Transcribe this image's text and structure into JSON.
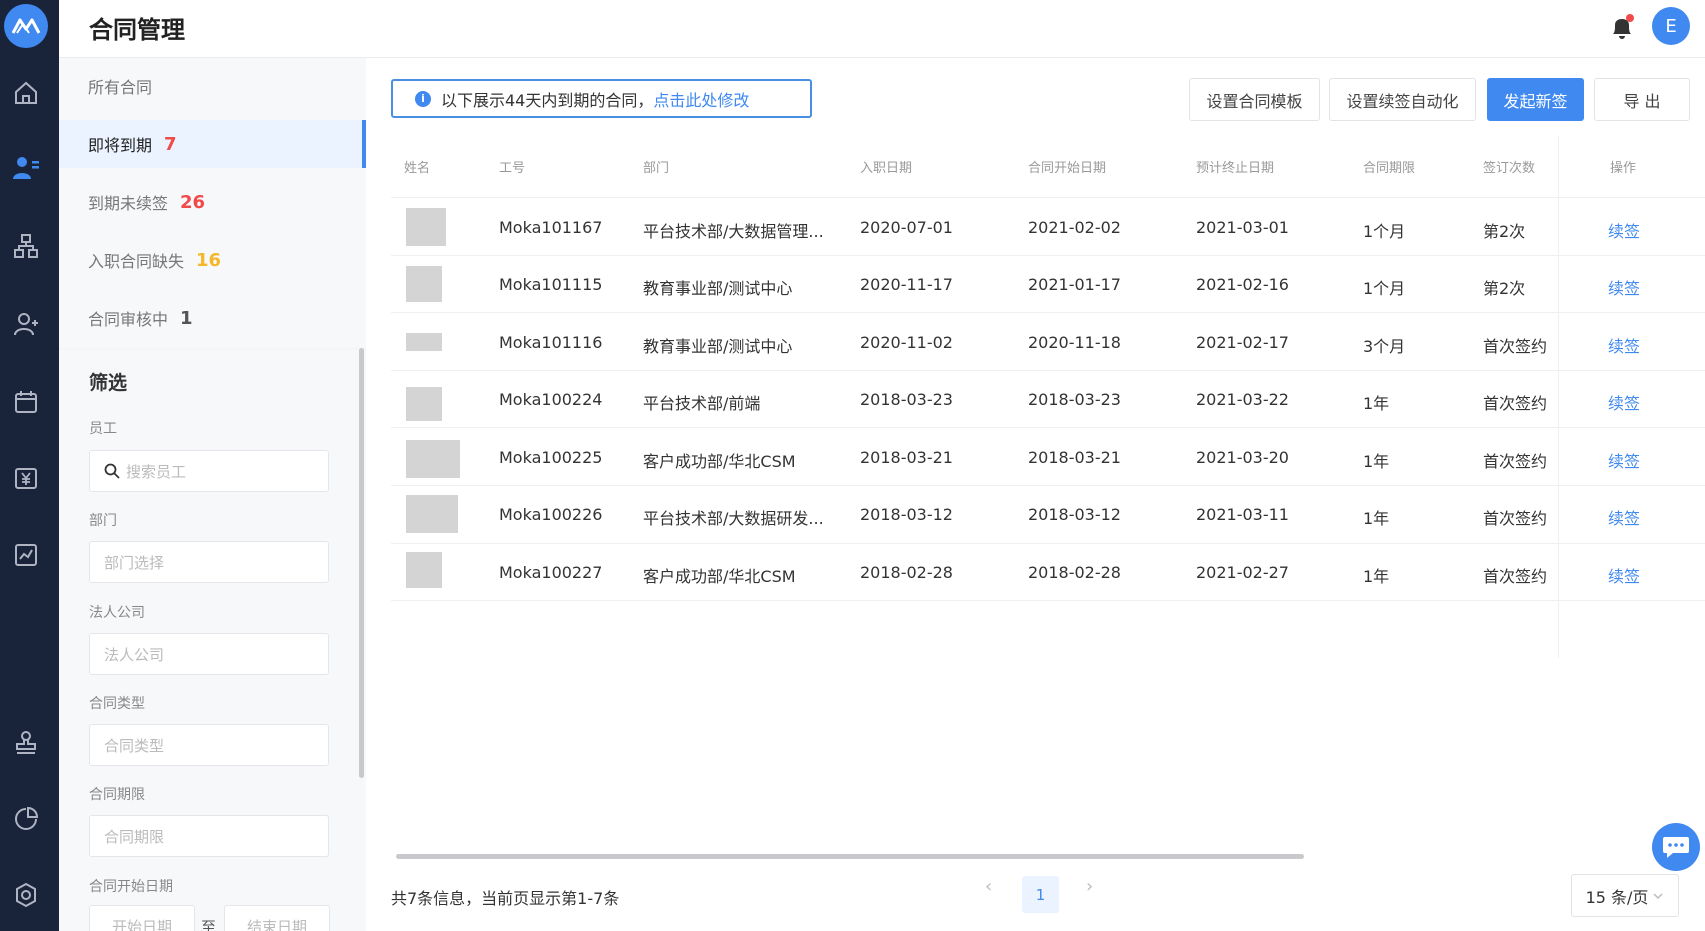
{
  "app": {
    "title": "合同管理",
    "avatar_letter": "E",
    "accent": "#3f89f0"
  },
  "nav": {
    "all": "所有合同",
    "items": [
      {
        "label": "即将到期",
        "count": "7",
        "color": "#f04a4a"
      },
      {
        "label": "到期未续签",
        "count": "26",
        "color": "#f04a4a"
      },
      {
        "label": "入职合同缺失",
        "count": "16",
        "color": "#f5b72a"
      },
      {
        "label": "合同审核中",
        "count": "1",
        "color": "#555555"
      }
    ]
  },
  "filter": {
    "title": "筛选",
    "employee_label": "员工",
    "employee_placeholder": "搜索员工",
    "dept_label": "部门",
    "dept_placeholder": "部门选择",
    "company_label": "法人公司",
    "company_placeholder": "法人公司",
    "type_label": "合同类型",
    "type_placeholder": "合同类型",
    "term_label": "合同期限",
    "term_placeholder": "合同期限",
    "start_label": "合同开始日期",
    "start_from": "开始日期",
    "sep": "至",
    "start_to": "结束日期"
  },
  "notice": {
    "text": "以下展示44天内到期的合同，",
    "link": "点击此处修改"
  },
  "toolbar": {
    "template": "设置合同模板",
    "auto": "设置续签自动化",
    "new": "发起新签",
    "export": "导 出"
  },
  "table": {
    "headers": [
      "姓名",
      "工号",
      "部门",
      "入职日期",
      "合同开始日期",
      "预计终止日期",
      "合同期限",
      "签订次数",
      "操作"
    ],
    "rows": [
      {
        "id": "Moka101167",
        "dept": "平台技术部/大数据管理...",
        "hire": "2020-07-01",
        "start": "2021-02-02",
        "end": "2021-03-01",
        "term": "1个月",
        "times": "第2次",
        "op": "续签"
      },
      {
        "id": "Moka101115",
        "dept": "教育事业部/测试中心",
        "hire": "2020-11-17",
        "start": "2021-01-17",
        "end": "2021-02-16",
        "term": "1个月",
        "times": "第2次",
        "op": "续签"
      },
      {
        "id": "Moka101116",
        "dept": "教育事业部/测试中心",
        "hire": "2020-11-02",
        "start": "2020-11-18",
        "end": "2021-02-17",
        "term": "3个月",
        "times": "首次签约",
        "op": "续签"
      },
      {
        "id": "Moka100224",
        "dept": "平台技术部/前端",
        "hire": "2018-03-23",
        "start": "2018-03-23",
        "end": "2021-03-22",
        "term": "1年",
        "times": "首次签约",
        "op": "续签"
      },
      {
        "id": "Moka100225",
        "dept": "客户成功部/华北CSM",
        "hire": "2018-03-21",
        "start": "2018-03-21",
        "end": "2021-03-20",
        "term": "1年",
        "times": "首次签约",
        "op": "续签"
      },
      {
        "id": "Moka100226",
        "dept": "平台技术部/大数据研发...",
        "hire": "2018-03-12",
        "start": "2018-03-12",
        "end": "2021-03-11",
        "term": "1年",
        "times": "首次签约",
        "op": "续签"
      },
      {
        "id": "Moka100227",
        "dept": "客户成功部/华北CSM",
        "hire": "2018-02-28",
        "start": "2018-02-28",
        "end": "2021-02-27",
        "term": "1年",
        "times": "首次签约",
        "op": "续签"
      }
    ]
  },
  "footer": {
    "info": "共7条信息，当前页显示第1-7条",
    "prev": "‹",
    "page": "1",
    "next": "›",
    "pagesize": "15 条/页"
  }
}
